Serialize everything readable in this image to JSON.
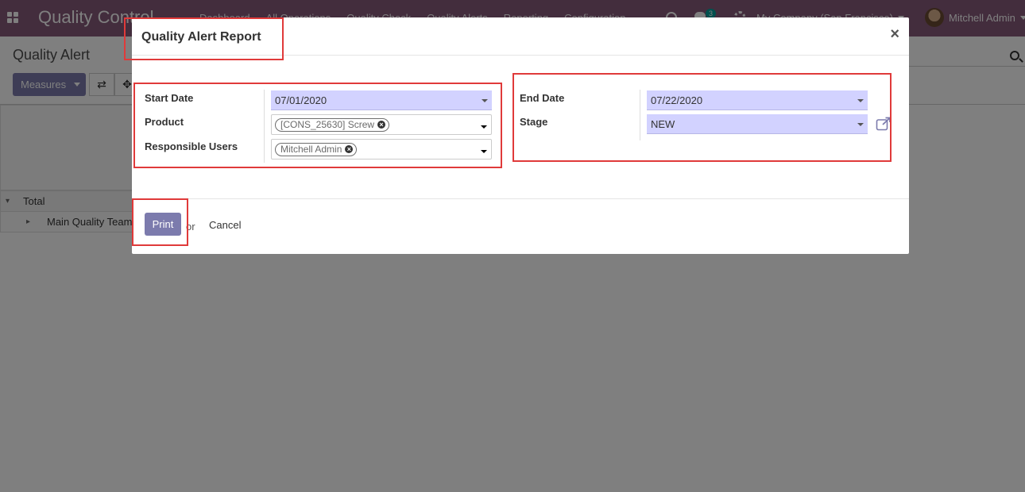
{
  "navbar": {
    "brand": "Quality Control",
    "menu": [
      "Dashboard",
      "All Operations",
      "Quality Check",
      "Quality Alerts",
      "Reporting",
      "Configuration"
    ],
    "chat_badge": "3",
    "company": "My Company (San Francisco)",
    "user": "Mitchell Admin",
    "color": "#875a7b"
  },
  "control_panel": {
    "title": "Quality Alert",
    "measures_label": "Measures"
  },
  "pivot": {
    "total_label": "Total",
    "row_label": "Main Quality Team"
  },
  "modal": {
    "title": "Quality Alert Report",
    "close_label": "×",
    "start_date_label": "Start Date",
    "start_date_value": "07/01/2020",
    "product_label": "Product",
    "product_tag": "[CONS_25630] Screw",
    "responsible_label": "Responsible Users",
    "responsible_tag": "Mitchell Admin",
    "end_date_label": "End Date",
    "end_date_value": "07/22/2020",
    "stage_label": "Stage",
    "stage_value": "NEW",
    "print_label": "Print",
    "or_label": "or",
    "cancel_label": "Cancel"
  },
  "colors": {
    "primary": "#7c7bad",
    "field_fill": "#d2d2ff",
    "highlight": "#e03a3a"
  }
}
